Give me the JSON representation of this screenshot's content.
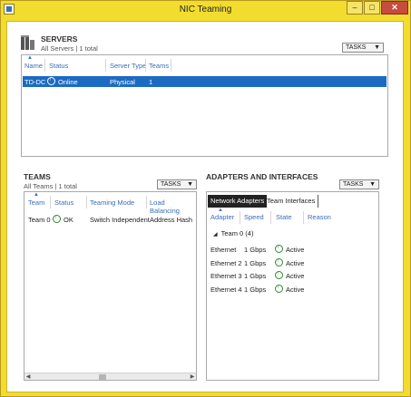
{
  "window": {
    "title": "NIC Teaming"
  },
  "servers": {
    "title": "SERVERS",
    "subtitle": "All Servers | 1 total",
    "tasks_label": "TASKS",
    "columns": [
      "Name",
      "Status",
      "Server Type",
      "Teams"
    ],
    "rows": [
      {
        "name": "TD-DC",
        "status": "Online",
        "server_type": "Physical",
        "teams": "1"
      }
    ]
  },
  "teams": {
    "title": "TEAMS",
    "subtitle": "All Teams | 1 total",
    "tasks_label": "TASKS",
    "columns": [
      "Team",
      "Status",
      "Teaming Mode",
      "Load Balancing"
    ],
    "rows": [
      {
        "team": "Team 0",
        "status": "OK",
        "mode": "Switch Independent",
        "lb": "Address Hash"
      }
    ]
  },
  "adapters": {
    "title": "ADAPTERS AND INTERFACES",
    "tasks_label": "TASKS",
    "tabs": [
      "Network Adapters",
      "Team Interfaces"
    ],
    "columns": [
      "Adapter",
      "Speed",
      "State",
      "Reason"
    ],
    "group": "Team 0 (4)",
    "rows": [
      {
        "adapter": "Ethernet",
        "speed": "1 Gbps",
        "state": "Active"
      },
      {
        "adapter": "Ethernet 2",
        "speed": "1 Gbps",
        "state": "Active"
      },
      {
        "adapter": "Ethernet 3",
        "speed": "1 Gbps",
        "state": "Active"
      },
      {
        "adapter": "Ethernet 4",
        "speed": "1 Gbps",
        "state": "Active"
      }
    ]
  }
}
